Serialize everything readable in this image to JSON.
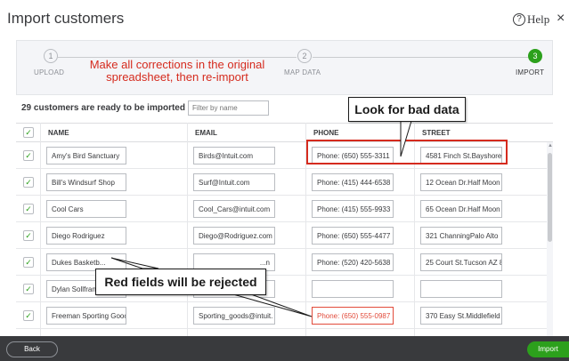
{
  "header": {
    "title": "Import customers",
    "help_label": "Help",
    "help_glyph": "?",
    "close_glyph": "×"
  },
  "stepper": {
    "steps": [
      {
        "number": "1",
        "label": "UPLOAD",
        "state": "done"
      },
      {
        "number": "2",
        "label": "MAP DATA",
        "state": "done"
      },
      {
        "number": "3",
        "label": "IMPORT",
        "state": "active"
      }
    ],
    "annotation": "Make all corrections in the original spreadsheet, then re-import"
  },
  "summary": {
    "text": "29 customers are ready to be imported",
    "filter_placeholder": "Filter by name"
  },
  "table": {
    "columns": [
      "NAME",
      "EMAIL",
      "PHONE",
      "STREET"
    ],
    "check_glyph": "✓",
    "rows": [
      {
        "name": "Amy's Bird Sanctuary",
        "email": "Birds@Intuit.com",
        "phone": "Phone: (650) 555-3311",
        "street": "4581 Finch St.Bayshore"
      },
      {
        "name": "Bill's Windsurf Shop",
        "email": "Surf@Intuit.com",
        "phone": "Phone: (415) 444-6538",
        "street": "12 Ocean Dr.Half Moon"
      },
      {
        "name": "Cool Cars",
        "email": "Cool_Cars@intuit.com",
        "phone": "Phone: (415) 555-9933",
        "street": "65 Ocean Dr.Half Moon"
      },
      {
        "name": "Diego Rodriguez",
        "email": "Diego@Rodriguez.com",
        "phone": "Phone: (650) 555-4477",
        "street": "321 ChanningPalo Alto"
      },
      {
        "name": "Dukes Basketb...",
        "email": "...n",
        "phone": "Phone: (520) 420-5638",
        "street": "25 Court St.Tucson AZ 8"
      },
      {
        "name": "Dylan Sollfrank",
        "email": "",
        "phone": "",
        "street": ""
      },
      {
        "name": "Freeman Sporting Gooc",
        "email": "Sporting_goods@intuit.",
        "phone": "Phone: (650) 555-0987",
        "street": "370 Easy St.Middlefield"
      }
    ]
  },
  "annotations": {
    "bad_data": "Look for bad data",
    "red_fields": "Red fields will be rejected"
  },
  "footer": {
    "back_label": "Back",
    "import_label": "Import"
  },
  "colors": {
    "accent_green": "#2ca01c",
    "error_red": "#e24b3b",
    "footer_bg": "#393a3d"
  }
}
